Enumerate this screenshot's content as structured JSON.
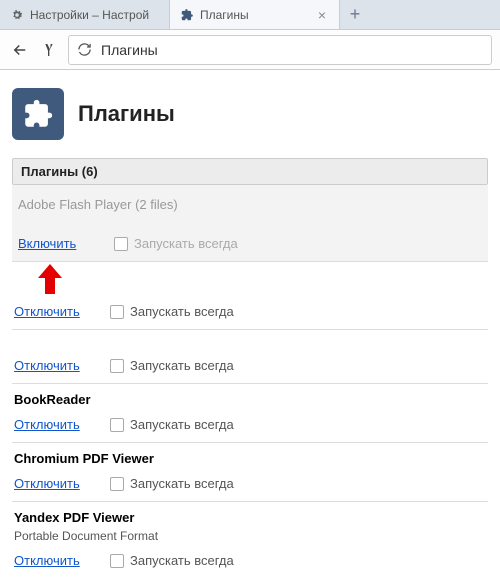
{
  "tabs": {
    "settings": {
      "title": "Настройки – Настрой"
    },
    "plugins": {
      "title": "Плагины"
    }
  },
  "address": {
    "text": "Плагины"
  },
  "header": {
    "title": "Плагины"
  },
  "section": {
    "label": "Плагины (6)"
  },
  "labels": {
    "enable": "Включить",
    "disable": "Отключить",
    "always_run": "Запускать всегда"
  },
  "plugins": [
    {
      "name": "Adobe Flash Player",
      "files": "(2 files)",
      "enabled": false
    },
    {
      "name": "",
      "enabled": true
    },
    {
      "name": "",
      "enabled": true
    },
    {
      "name": "BookReader",
      "enabled": true
    },
    {
      "name": "Chromium PDF Viewer",
      "enabled": true
    },
    {
      "name": "Yandex PDF Viewer",
      "sub": "Portable Document Format",
      "enabled": true
    }
  ]
}
